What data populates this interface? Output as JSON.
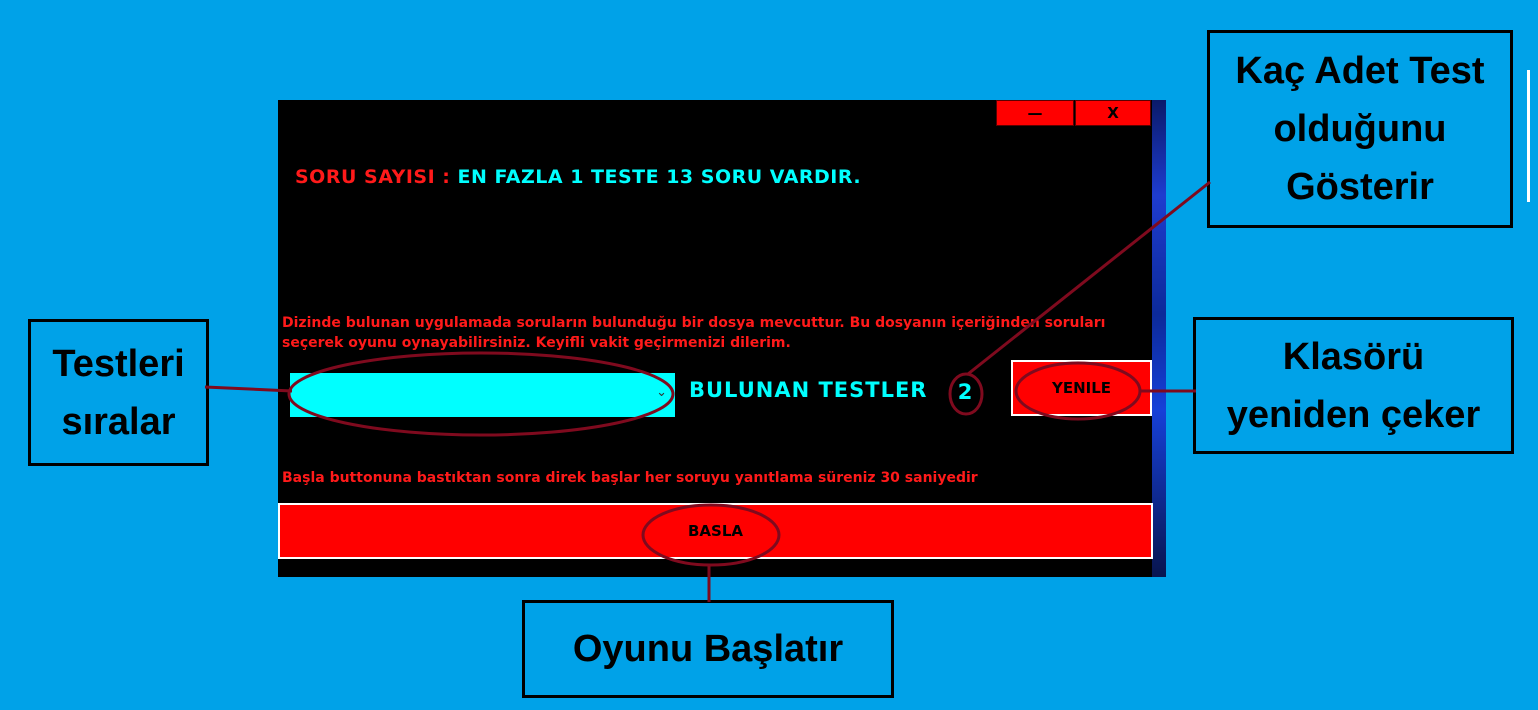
{
  "window": {
    "minimize_label": "—",
    "close_label": "X"
  },
  "question_count": {
    "label": "SORU SAYISI :",
    "value": "EN FAZLA 1 TESTE 13 SORU VARDIR."
  },
  "info_text": "Dizinde bulunan uygulamada soruların bulunduğu bir dosya mevcuttur. Bu dosyanın içeriğinden soruları seçerek oyunu oynayabilirsiniz. Keyifli vakit geçirmenizi dilerim.",
  "test_select": {
    "selected_value": ""
  },
  "found_tests": {
    "label": "BULUNAN TESTLER",
    "count": "2"
  },
  "refresh_button": "YENILE",
  "timer_info": "Başla buttonuna bastıktan sonra direk başlar her soruyu yanıtlama süreniz  30 saniyedir",
  "start_button": "BASLA",
  "callouts": {
    "test_count": [
      "Kaç Adet Test",
      "olduğunu",
      "Gösterir"
    ],
    "sort_tests": [
      "Testleri",
      "sıralar"
    ],
    "refresh": [
      "Klasörü",
      "yeniden çeker"
    ],
    "start": [
      "Oyunu Başlatır"
    ]
  },
  "colors": {
    "background": "#00a2e8",
    "window": "#000000",
    "accent_red": "#ff0000",
    "accent_cyan": "#00ffff",
    "annotation": "#7f0a1e"
  }
}
